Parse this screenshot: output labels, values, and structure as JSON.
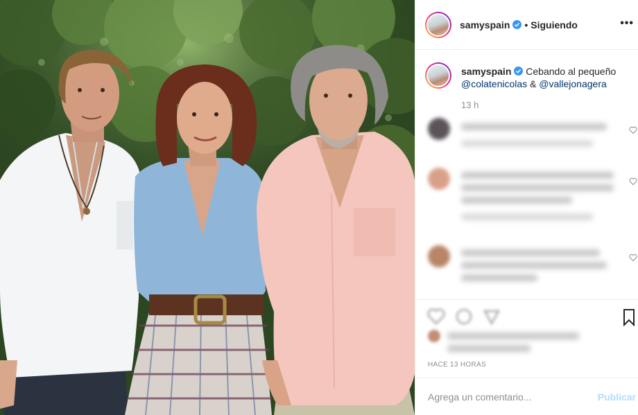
{
  "post": {
    "username": "samyspain",
    "follow_separator": "•",
    "follow_status": "Siguiendo",
    "more_label": "•••",
    "caption_user": "samyspain",
    "caption_text": "Cebando al pequeño",
    "mention_1": "@colatenicolas",
    "caption_amp": "&",
    "mention_2": "@vallejonagera",
    "caption_time": "13 h",
    "posted_ago": "HACE 13 HORAS",
    "comment_placeholder": "Agrega un comentario...",
    "publish_label": "Publicar"
  },
  "colors": {
    "verified_blue": "#3897f0",
    "mention_blue": "#00376b",
    "publish_disabled": "#b3dbff",
    "muted_text": "#8e8e8e"
  },
  "icons": [
    "more-icon",
    "verified-icon",
    "heart-icon",
    "comment-icon",
    "share-icon",
    "bookmark-icon"
  ]
}
